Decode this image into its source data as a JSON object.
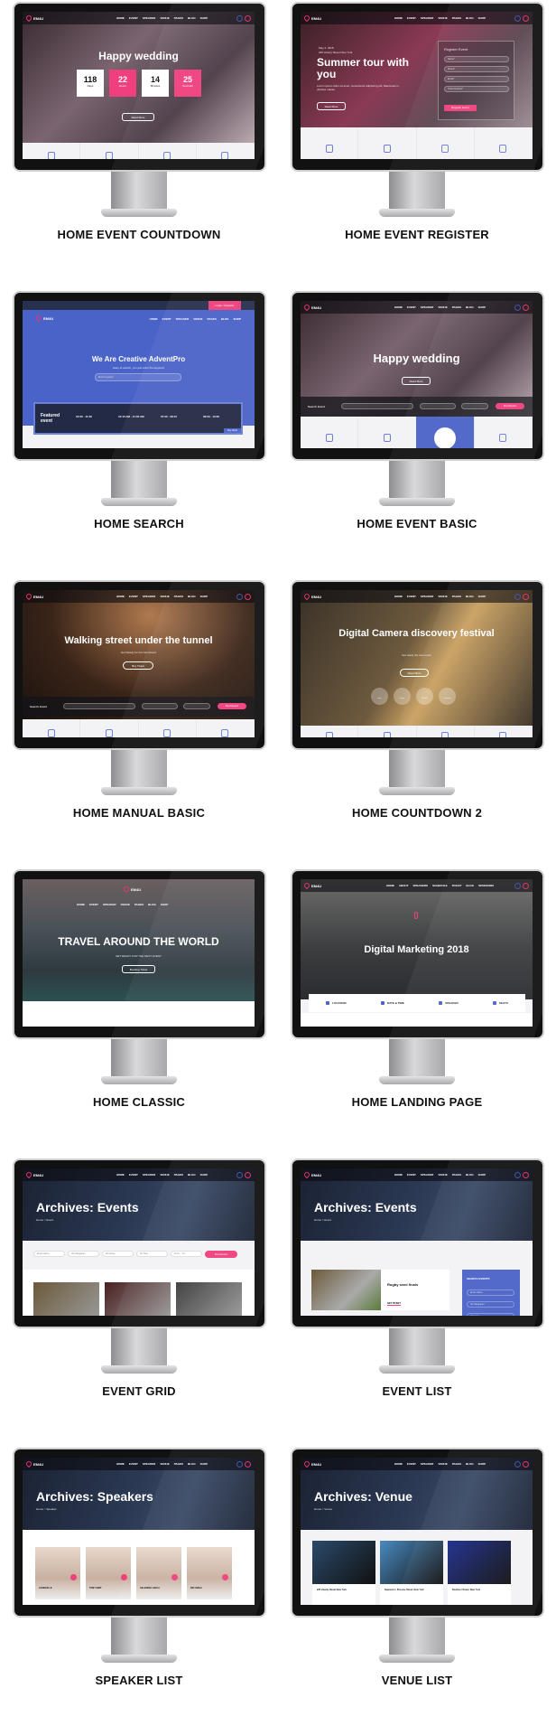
{
  "brand": {
    "logo": "EM4U",
    "accent": "#ef3f7c",
    "blue": "#4a5fc8"
  },
  "nav": [
    "HOME",
    "EVENT",
    "SPEAKER",
    "VENUE",
    "PAGES",
    "BLOG",
    "SHOP"
  ],
  "landing_nav": [
    "HOME",
    "ABOUT",
    "SPEAKERS",
    "SCHEDULE",
    "TICKET",
    "BLOG",
    "SPONSORS"
  ],
  "demos": [
    {
      "label": "HOME EVENT COUNTDOWN",
      "type": "countdown",
      "title": "Happy wedding",
      "button": "Read More",
      "countdown": [
        {
          "value": "118",
          "unit": "Days"
        },
        {
          "value": "22",
          "unit": "Hours"
        },
        {
          "value": "14",
          "unit": "Minutes"
        },
        {
          "value": "25",
          "unit": "Seconds"
        }
      ]
    },
    {
      "label": "HOME EVENT REGISTER",
      "type": "register",
      "date": "May 2, 2018",
      "address": "225 Liberty Street New York",
      "title": "Summer tour with you",
      "desc": "Lorem ipsum dolor sit amet, consectetur adipiscing elit, Maecenas in ultricies massa",
      "button": "Read More",
      "form": {
        "title": "Register Event",
        "fields": [
          "Name*",
          "Phone*",
          "Email*",
          "Ticket Number*"
        ],
        "submit": "Register Event"
      }
    },
    {
      "label": "HOME SEARCH",
      "type": "search",
      "login": "Login / Register",
      "title": "We Are Creative AdventPro",
      "subtitle": "Easy to search, you just enter the keyword",
      "placeholder": "Enter Keyword",
      "featured": "Featured event",
      "times": [
        "10:20 - 11:20",
        "10:15 AM - 11:30 AM",
        "07:00 - 08:15",
        "09:00 - 10:30"
      ],
      "buy": "Buy ticket"
    },
    {
      "label": "HOME EVENT BASIC",
      "type": "basic",
      "title": "Happy wedding",
      "button": "Read More",
      "search_label": "Search Event",
      "find": "Find Event"
    },
    {
      "label": "HOME MANUAL BASIC",
      "type": "manual",
      "title": "Walking street under the tunnel",
      "subtitle": "Get Ready for the Next Event",
      "button": "Buy Ticket",
      "search_label": "Search Event",
      "find": "Find Event"
    },
    {
      "label": "HOME COUNTDOWN 2",
      "type": "countdown2",
      "title": "Digital Camera discovery festival",
      "subtitle": "Get ready the next event",
      "button": "Read More",
      "units": [
        "Days",
        "Hours",
        "Minutes",
        "Seconds"
      ]
    },
    {
      "label": "HOME CLASSIC",
      "type": "classic",
      "title": "TRAVEL AROUND THE WORLD",
      "subtitle": "GET READY FOR THE NEXT EVENT",
      "button": "Booking Ticket"
    },
    {
      "label": "HOME LANDING PAGE",
      "type": "landing",
      "title": "Digital Marketing 2018",
      "info": [
        "LOCATION",
        "DATE & TIME",
        "SPEAKER",
        "SEATS"
      ]
    },
    {
      "label": "EVENT GRID",
      "type": "grid",
      "title": "Archives: Events",
      "crumb": "Home > Event",
      "filters": [
        "Enter Name...",
        "All Categories",
        "All Venue",
        "All Time",
        "From... To..."
      ],
      "find": "Find Event"
    },
    {
      "label": "EVENT LIST",
      "type": "list",
      "title": "Archives: Events",
      "crumb": "Home > Event",
      "event": "Rugby semi finals",
      "ticket": "GET TICKET",
      "sidebar": "SEARCH EVENTS",
      "sidebar_fields": [
        "Enter Name...",
        "All Categories",
        "All Venue"
      ]
    },
    {
      "label": "SPEAKER LIST",
      "type": "speakers",
      "title": "Archives: Speakers",
      "crumb": "Home > Speaker",
      "speakers": [
        "LOOKER LE",
        "TONY SMIT",
        "CELENINE LENCA",
        "BIO SMILE"
      ]
    },
    {
      "label": "VENUE LIST",
      "type": "venues",
      "title": "Archives: Venue",
      "crumb": "Home > Venue",
      "venues": [
        "225 Liberty Street New York",
        "Seamore's, Broome Street, New York",
        "Bowlmor Street, New York"
      ]
    }
  ]
}
